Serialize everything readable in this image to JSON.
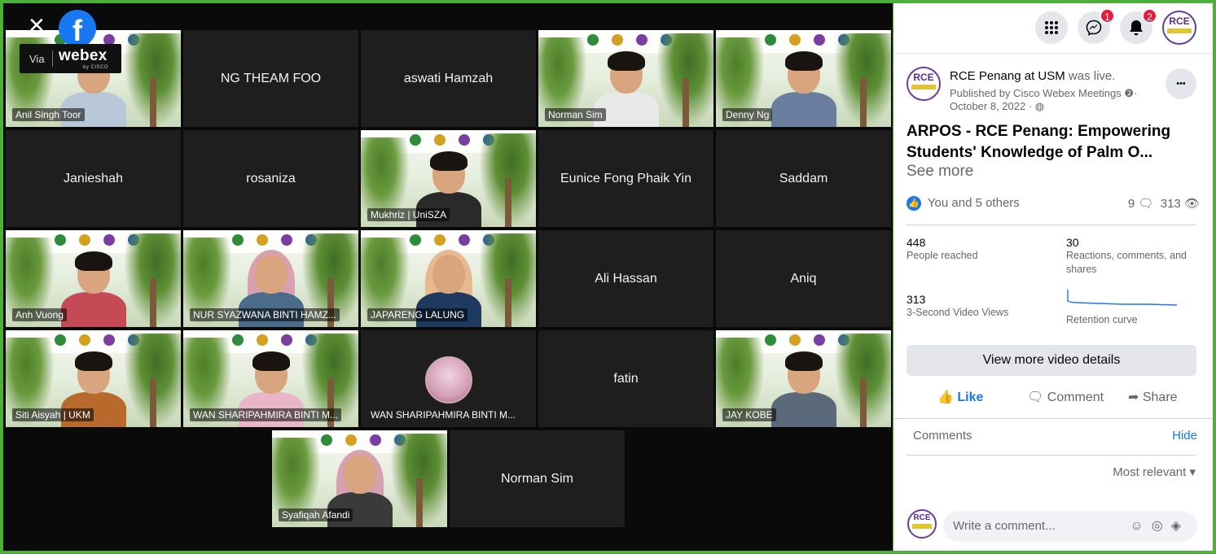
{
  "overlay": {
    "close_glyph": "✕",
    "facebook_glyph": "f",
    "via": "Via",
    "webex": "webex",
    "cisco": "by CISCO"
  },
  "tiles": [
    {
      "kind": "video",
      "label": "Anil Singh Toor"
    },
    {
      "kind": "name",
      "label": "NG THEAM FOO"
    },
    {
      "kind": "name",
      "label": "aswati Hamzah"
    },
    {
      "kind": "video",
      "label": "Norman Sim"
    },
    {
      "kind": "video",
      "label": "Denny Ng"
    },
    {
      "kind": "name",
      "label": "Janieshah"
    },
    {
      "kind": "name",
      "label": "rosaniza"
    },
    {
      "kind": "video",
      "label": "Mukhriz | UniSZA"
    },
    {
      "kind": "name",
      "label": "Eunice Fong Phaik Yin"
    },
    {
      "kind": "name",
      "label": "Saddam"
    },
    {
      "kind": "video",
      "label": "Anh Vuong"
    },
    {
      "kind": "video",
      "label": "NUR SYAZWANA BINTI HAMZ..."
    },
    {
      "kind": "video",
      "label": "JAPARENG LALUNG"
    },
    {
      "kind": "name",
      "label": "Ali Hassan"
    },
    {
      "kind": "name",
      "label": "Aniq"
    },
    {
      "kind": "video",
      "label": "Siti Aisyah | UKM"
    },
    {
      "kind": "video",
      "label": "WAN SHARIPAHMIRA BINTI M..."
    },
    {
      "kind": "avatar",
      "label": "WAN SHARIPAHMIRA BINTI M..."
    },
    {
      "kind": "name",
      "label": "fatin"
    },
    {
      "kind": "video",
      "label": "JAY KOBE"
    },
    {
      "kind": "video",
      "label": "Syafiqah Afandi"
    },
    {
      "kind": "name",
      "label": "Norman Sim"
    }
  ],
  "topbar": {
    "menu_icon": "grid-menu-icon",
    "messenger_badge": "1",
    "notifications_badge": "2",
    "avatar_text": "RCE"
  },
  "post": {
    "page_name": "RCE Penang at USM",
    "status": "was live.",
    "published_by": "Published by Cisco Webex Meetings",
    "date": "October 8, 2022",
    "more_glyph": "•••",
    "title": "ARPOS - RCE Penang: Empowering Students' Knowledge of Palm O...",
    "see_more": "See more",
    "reactions_text": "You and 5 others",
    "comments_count": "9",
    "views_count": "313"
  },
  "insights": {
    "reached_value": "448",
    "reached_label": "People reached",
    "engagement_value": "30",
    "engagement_label": "Reactions, comments, and shares",
    "video_views_value": "313",
    "video_views_label": "3-Second Video Views",
    "retention_label": "Retention curve"
  },
  "details_button": "View more video details",
  "actions": {
    "like": "Like",
    "comment": "Comment",
    "share": "Share"
  },
  "comments": {
    "title": "Comments",
    "hide": "Hide",
    "sort": "Most relevant",
    "placeholder": "Write a comment..."
  },
  "colors": {
    "facebook_blue": "#1877f2",
    "frame_green": "#4caf3a",
    "badge_red": "#e41e3f"
  }
}
